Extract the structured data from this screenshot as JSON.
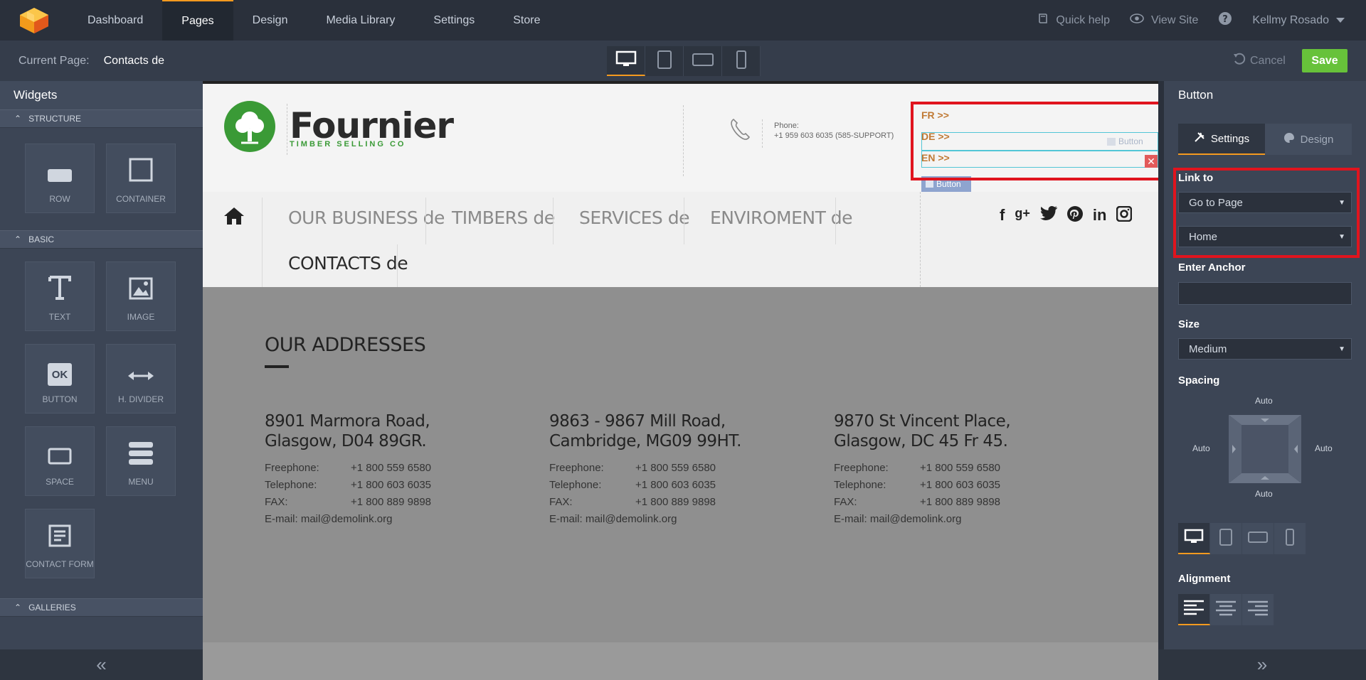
{
  "topnav": {
    "items": [
      "Dashboard",
      "Pages",
      "Design",
      "Media Library",
      "Settings",
      "Store"
    ],
    "active": "Pages",
    "quick_help": "Quick help",
    "view_site": "View Site",
    "user": "Kellmy Rosado"
  },
  "toolbar": {
    "current_page_label": "Current Page:",
    "current_page_value": "Contacts de",
    "cancel": "Cancel",
    "save": "Save"
  },
  "sidebar": {
    "title": "Widgets",
    "sections": {
      "structure": "STRUCTURE",
      "basic": "BASIC",
      "galleries": "GALLERIES"
    },
    "widgets": {
      "row": "ROW",
      "container": "CONTAINER",
      "text": "TEXT",
      "image": "IMAGE",
      "button": "BUTTON",
      "hdivider": "H. DIVIDER",
      "space": "SPACE",
      "menu": "MENU",
      "contact_form": "CONTACT FORM"
    },
    "button_icon_text": "OK"
  },
  "site": {
    "brand_name": "Fournier",
    "brand_sub": "TIMBER SELLING CO",
    "phone_label": "Phone:",
    "phone_number": "+1 959 603 6035 (585-SUPPORT)",
    "langs": [
      "FR >>",
      "DE >>",
      "EN >>"
    ],
    "button_ghost": "Button",
    "button_tag": "Button",
    "menu": [
      "OUR BUSINESS de",
      "TIMBERS de",
      "SERVICES de",
      "ENVIROMENT de",
      "CONTACTS de"
    ],
    "socials": [
      "f",
      "g+",
      "twitter",
      "pinterest",
      "in",
      "instagram"
    ],
    "addresses_title": "OUR ADDRESSES",
    "addresses": [
      {
        "line1": "8901 Marmora Road,",
        "line2": "Glasgow, D04 89GR.",
        "freephone_label": "Freephone:",
        "freephone": "+1 800 559 6580",
        "telephone_label": "Telephone:",
        "telephone": "+1 800 603 6035",
        "fax_label": "FAX:",
        "fax": "+1 800 889 9898",
        "email": "E-mail: mail@demolink.org"
      },
      {
        "line1": "9863 - 9867 Mill Road,",
        "line2": "Cambridge, MG09 99HT.",
        "freephone_label": "Freephone:",
        "freephone": "+1 800 559 6580",
        "telephone_label": "Telephone:",
        "telephone": "+1 800 603 6035",
        "fax_label": "FAX:",
        "fax": "+1 800 889 9898",
        "email": "E-mail: mail@demolink.org"
      },
      {
        "line1": "9870 St Vincent Place,",
        "line2": "Glasgow, DC 45 Fr 45.",
        "freephone_label": "Freephone:",
        "freephone": "+1 800 559 6580",
        "telephone_label": "Telephone:",
        "telephone": "+1 800 603 6035",
        "fax_label": "FAX:",
        "fax": "+1 800 889 9898",
        "email": "E-mail: mail@demolink.org"
      }
    ]
  },
  "rpanel": {
    "title": "Button",
    "tab_settings": "Settings",
    "tab_design": "Design",
    "link_to_label": "Link to",
    "link_to_value": "Go to Page",
    "page_value": "Home",
    "anchor_label": "Enter Anchor",
    "anchor_value": "",
    "size_label": "Size",
    "size_value": "Medium",
    "spacing_label": "Spacing",
    "spacing_top": "Auto",
    "spacing_left": "Auto",
    "spacing_right": "Auto",
    "spacing_bottom": "Auto",
    "alignment_label": "Alignment"
  },
  "colors": {
    "accent": "#f49a1f",
    "save_green": "#67c23a",
    "highlight_red": "#e0141e",
    "brand_green": "#3a9a36",
    "lang_orange": "#c07a35"
  }
}
